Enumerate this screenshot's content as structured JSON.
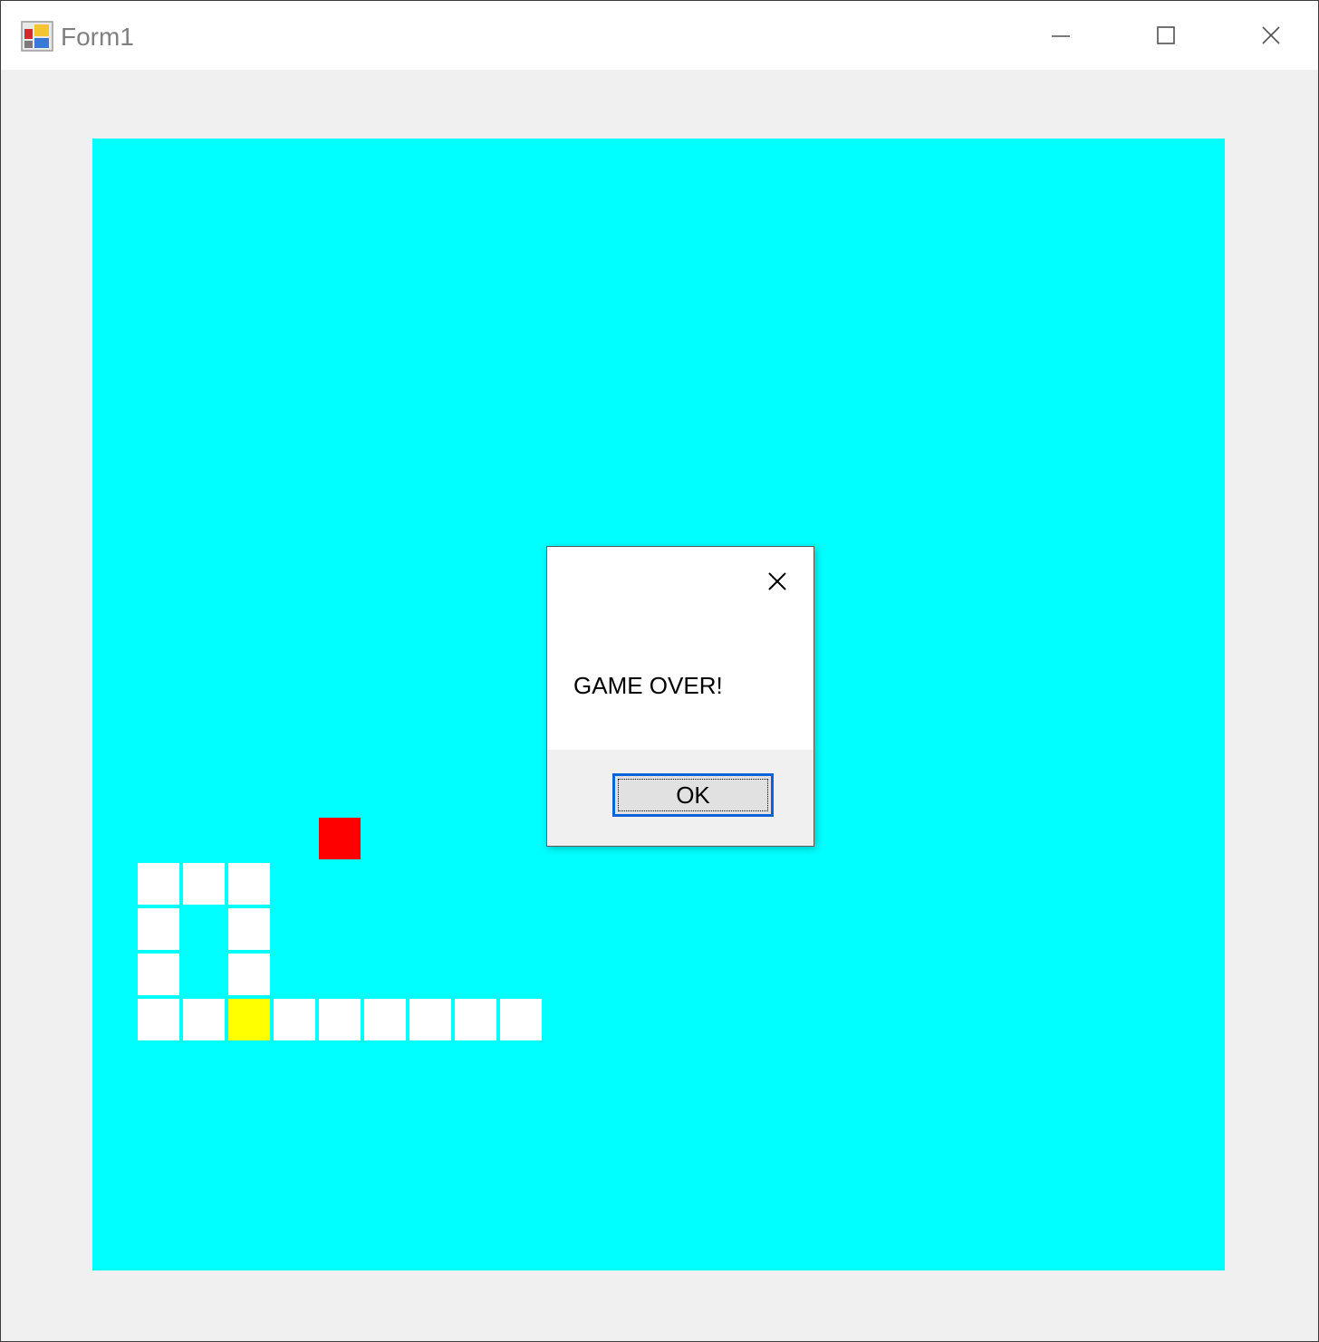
{
  "window": {
    "title": "Form1",
    "controls": {
      "minimize_icon": "minimize-icon",
      "maximize_icon": "maximize-icon",
      "close_icon": "close-icon"
    }
  },
  "game": {
    "board_color": "#00ffff",
    "grid": {
      "columns": 25,
      "rows": 25
    },
    "food": {
      "color": "#ff0000",
      "col": 5,
      "row": 15
    },
    "snake": {
      "body_color": "#ffffff",
      "head_color": "#ffff00",
      "head": {
        "col": 3,
        "row": 19
      },
      "body": [
        {
          "col": 1,
          "row": 16
        },
        {
          "col": 2,
          "row": 16
        },
        {
          "col": 3,
          "row": 16
        },
        {
          "col": 1,
          "row": 17
        },
        {
          "col": 3,
          "row": 17
        },
        {
          "col": 1,
          "row": 18
        },
        {
          "col": 3,
          "row": 18
        },
        {
          "col": 1,
          "row": 19
        },
        {
          "col": 2,
          "row": 19
        },
        {
          "col": 4,
          "row": 19
        },
        {
          "col": 5,
          "row": 19
        },
        {
          "col": 6,
          "row": 19
        },
        {
          "col": 7,
          "row": 19
        },
        {
          "col": 8,
          "row": 19
        },
        {
          "col": 9,
          "row": 19
        }
      ]
    }
  },
  "dialog": {
    "message": "GAME OVER!",
    "ok_label": "OK",
    "close_icon": "close-icon"
  }
}
